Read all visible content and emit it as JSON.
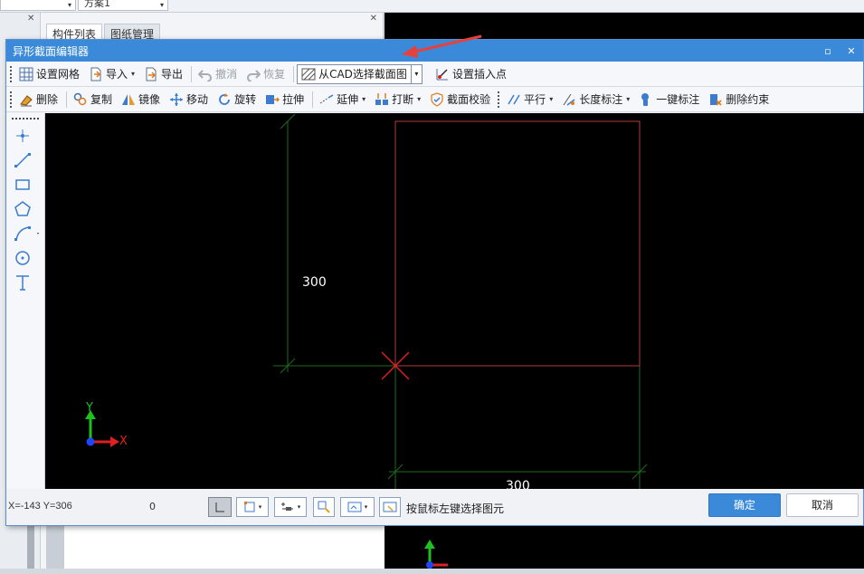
{
  "background": {
    "scheme_dropdown": "方案1",
    "panel_tabs": [
      {
        "label": "构件列表",
        "active": true
      },
      {
        "label": "图纸管理",
        "active": false
      }
    ]
  },
  "dialog": {
    "title": "异形截面编辑器",
    "toolbar1": {
      "set_grid": "设置网格",
      "import": "导入",
      "export": "导出",
      "undo": "撤消",
      "redo": "恢复",
      "select_from_cad": "从CAD选择截面图",
      "set_insert_point": "设置插入点"
    },
    "toolbar2": {
      "delete": "删除",
      "copy": "复制",
      "mirror": "镜像",
      "move": "移动",
      "rotate": "旋转",
      "stretch": "拉伸",
      "extend": "延伸",
      "break": "打断",
      "section_check": "截面校验",
      "parallel": "平行",
      "length_dim": "长度标注",
      "one_key_dim": "一键标注",
      "delete_constraint": "删除约束"
    },
    "canvas": {
      "dim_vertical": "300",
      "dim_horizontal": "300",
      "axis_x": "X",
      "axis_y": "Y"
    },
    "status": {
      "coords": "X=-143 Y=306",
      "value": "0",
      "hint": "按鼠标左键选择图元"
    },
    "ok": "确定",
    "cancel": "取消"
  },
  "colors": {
    "title_bar": "#3b8ad9",
    "shape_outline": "#b03a3a",
    "dimension_lines": "#1f6b1f",
    "insert_point_marker": "#e02020",
    "annotation_arrow": "#e8403a"
  }
}
